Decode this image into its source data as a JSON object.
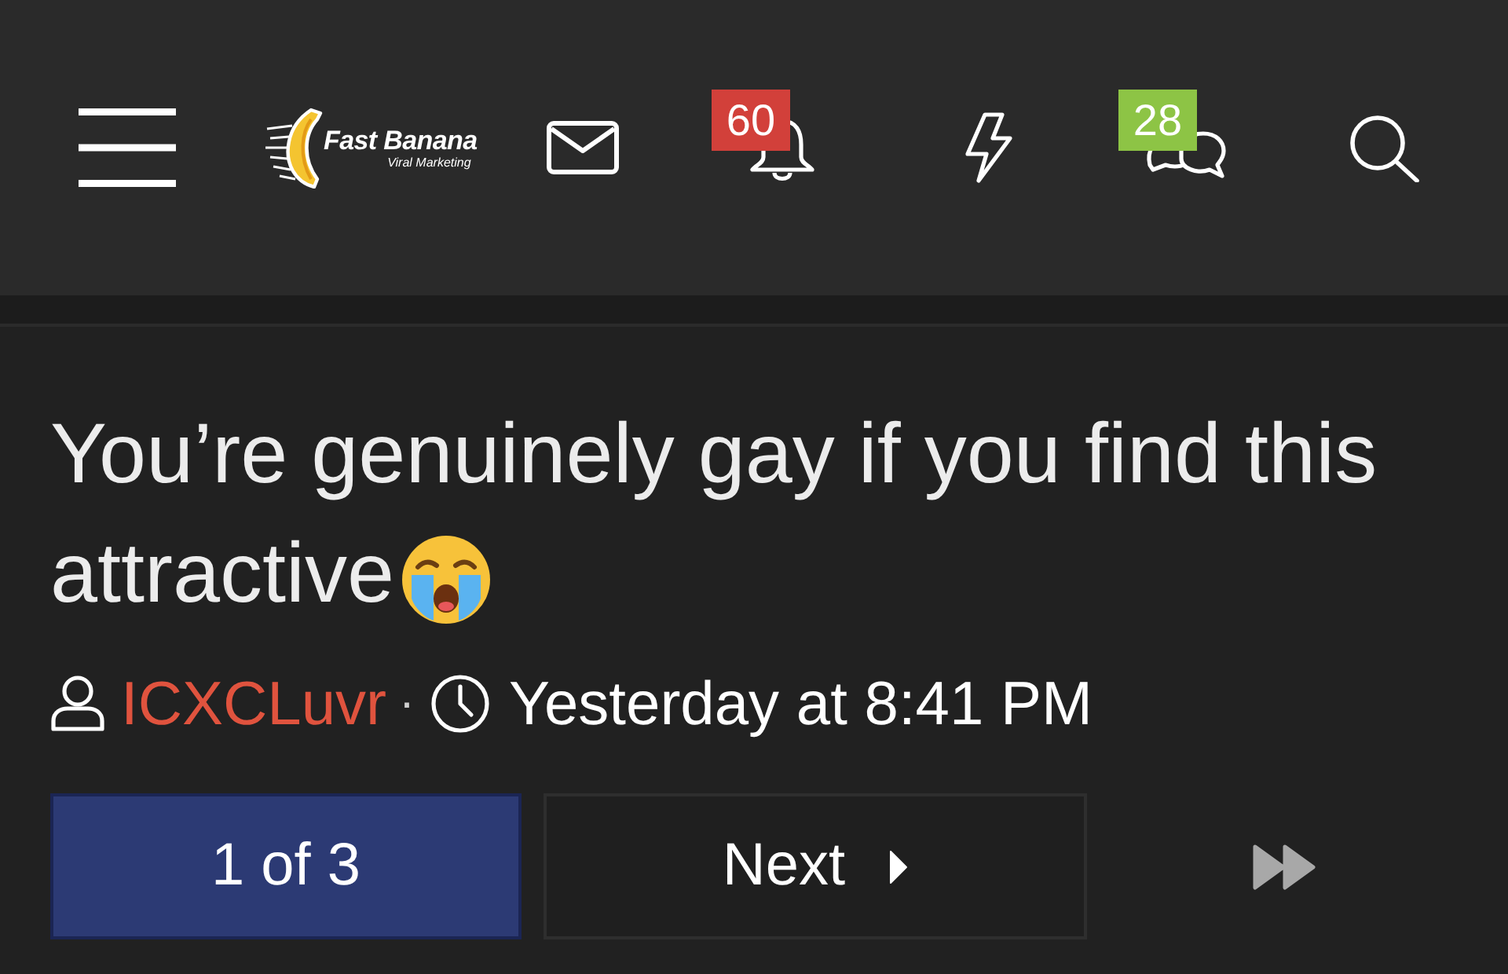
{
  "header": {
    "logo": {
      "name": "Fast Banana",
      "tagline": "Viral Marketing"
    },
    "nav": [
      {
        "kind": "menu"
      },
      {
        "kind": "logo"
      },
      {
        "kind": "mail"
      },
      {
        "kind": "alerts",
        "badge": "60",
        "color": "#d2403a"
      },
      {
        "kind": "whats-new"
      },
      {
        "kind": "conversations",
        "badge": "28",
        "color": "#8dc445"
      },
      {
        "kind": "search"
      }
    ]
  },
  "thread": {
    "title_lines": [
      "You’re genuinely gay if you find this",
      "attractive"
    ],
    "author": "ICXCLuvr",
    "separator": "·",
    "time": "Yesterday at 8:41 PM"
  },
  "pagination": {
    "pages": [
      {
        "label": "1 of 3",
        "selected": true
      }
    ],
    "next": "Next"
  }
}
